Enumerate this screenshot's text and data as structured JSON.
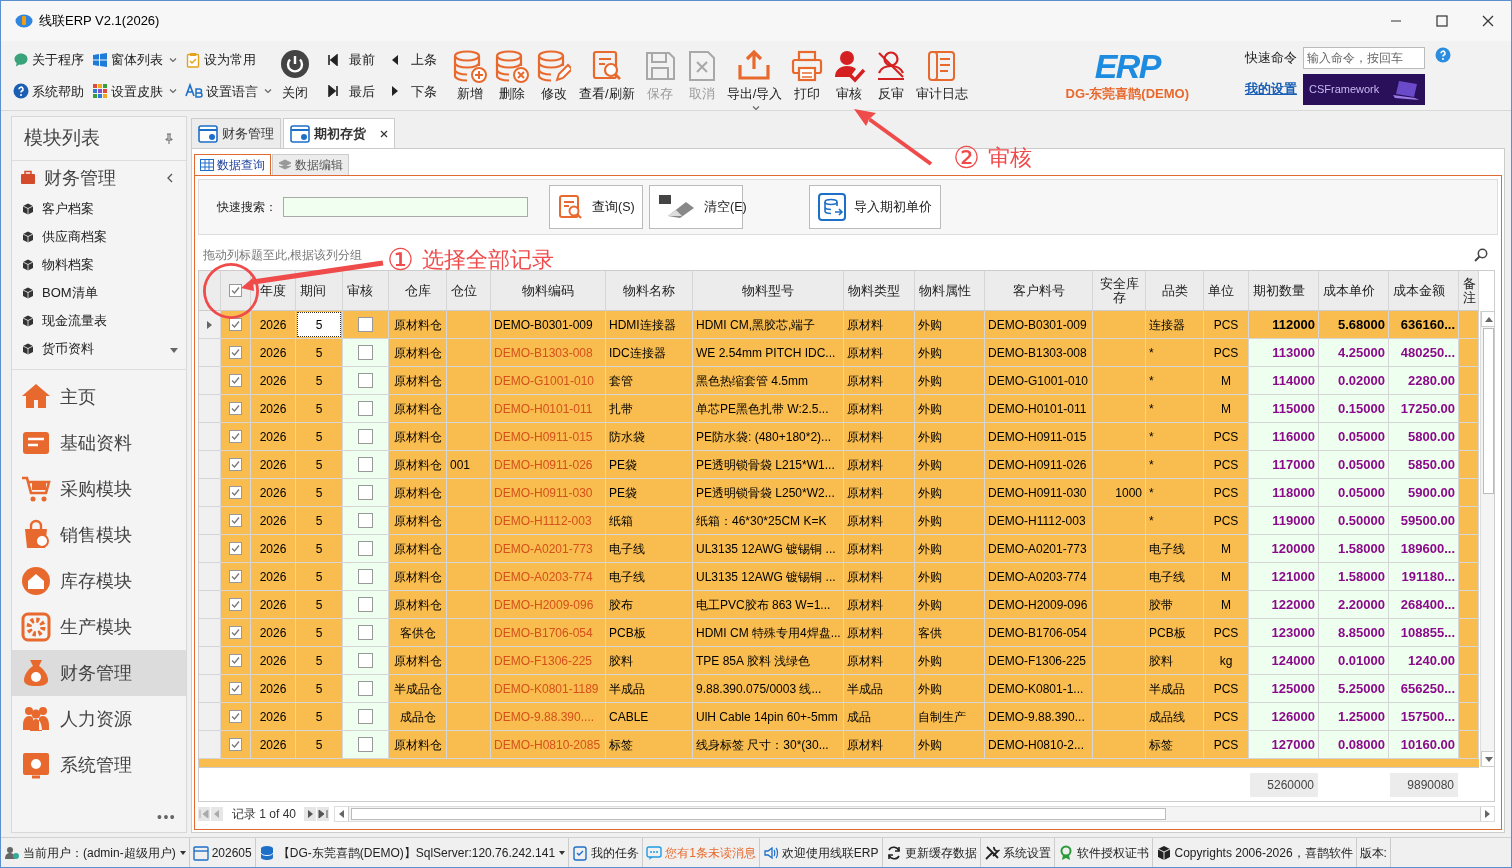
{
  "window": {
    "title": "线联ERP V2.1(2026)"
  },
  "toolbar": {
    "quick_links": [
      {
        "label": "关于程序",
        "dropdown": false
      },
      {
        "label": "窗体列表",
        "dropdown": true
      },
      {
        "label": "设为常用",
        "dropdown": false
      },
      {
        "label": "系统帮助",
        "dropdown": false
      },
      {
        "label": "设置皮肤",
        "dropdown": true
      },
      {
        "label": "设置语言",
        "dropdown": true
      }
    ],
    "close": "关闭",
    "nav": [
      "最前",
      "上条",
      "最后",
      "下条"
    ],
    "buttons": [
      {
        "label": "新增",
        "disabled": false,
        "dropdown": false
      },
      {
        "label": "删除",
        "disabled": false,
        "dropdown": false
      },
      {
        "label": "修改",
        "disabled": false,
        "dropdown": false
      },
      {
        "label": "查看/刷新",
        "disabled": false,
        "dropdown": false
      },
      {
        "label": "保存",
        "disabled": true,
        "dropdown": false
      },
      {
        "label": "取消",
        "disabled": true,
        "dropdown": false
      },
      {
        "label": "导出/导入",
        "disabled": false,
        "dropdown": true
      },
      {
        "label": "打印",
        "disabled": false,
        "dropdown": false
      },
      {
        "label": "审核",
        "disabled": false,
        "dropdown": false
      },
      {
        "label": "反审",
        "disabled": false,
        "dropdown": false
      },
      {
        "label": "审计日志",
        "disabled": false,
        "dropdown": false
      }
    ],
    "brand": {
      "logo": "ERP",
      "company": "DG-东莞喜鹊(DEMO)"
    },
    "quick_command": {
      "label": "快速命令",
      "placeholder": "输入命令，按回车"
    },
    "my_settings": "我的设置",
    "banner": "CSFramework"
  },
  "sidebar": {
    "title": "模块列表",
    "group": {
      "label": "财务管理",
      "expanded": true,
      "items": [
        "客户档案",
        "供应商档案",
        "物料档案",
        "BOM清单",
        "现金流量表",
        "货币资料"
      ]
    },
    "modules": [
      {
        "label": "主页",
        "selected": false
      },
      {
        "label": "基础资料",
        "selected": false
      },
      {
        "label": "采购模块",
        "selected": false
      },
      {
        "label": "销售模块",
        "selected": false
      },
      {
        "label": "库存模块",
        "selected": false
      },
      {
        "label": "生产模块",
        "selected": false
      },
      {
        "label": "财务管理",
        "selected": true
      },
      {
        "label": "人力资源",
        "selected": false
      },
      {
        "label": "系统管理",
        "selected": false
      }
    ],
    "more": "•••"
  },
  "tabs": [
    {
      "label": "财务管理",
      "selected": false,
      "closable": false
    },
    {
      "label": "期初存货",
      "selected": true,
      "closable": true
    }
  ],
  "subtabs": [
    {
      "label": "数据查询",
      "selected": true
    },
    {
      "label": "数据编辑",
      "selected": false
    }
  ],
  "search": {
    "label": "快速搜索：",
    "buttons": [
      "查询(S)",
      "清空(E)",
      "导入期初单价"
    ]
  },
  "group_hint": "拖动列标题至此,根据该列分组",
  "table": {
    "select_all_checked": true,
    "columns": [
      "年度",
      "期间",
      "审核",
      "仓库",
      "仓位",
      "物料编码",
      "物料名称",
      "物料型号",
      "物料类型",
      "物料属性",
      "客户料号",
      "安全库存",
      "品类",
      "单位",
      "期初数量",
      "成本单价",
      "成本金额",
      "备注"
    ],
    "rows": [
      {
        "focused": true,
        "selected": true,
        "audited": false,
        "year": "2026",
        "period": "5",
        "warehouse": "原材料仓",
        "code": "DEMO-B0301-009",
        "name": "HDMI连接器",
        "model": "HDMI CM,黑胶芯,端子",
        "type": "原材料",
        "attr": "外购",
        "customer_no": "DEMO-B0301-009",
        "category": "连接器",
        "unit": "PCS",
        "qty": "112000",
        "price": "5.68000",
        "amount": "636160..."
      },
      {
        "focused": false,
        "selected": true,
        "audited": false,
        "year": "2026",
        "period": "5",
        "warehouse": "原材料仓",
        "code": "DEMO-B1303-008",
        "name": "IDC连接器",
        "model": "WE 2.54mm PITCH IDC...",
        "type": "原材料",
        "attr": "外购",
        "customer_no": "DEMO-B1303-008",
        "category": "*",
        "unit": "PCS",
        "qty": "113000",
        "price": "4.25000",
        "amount": "480250..."
      },
      {
        "focused": false,
        "selected": true,
        "audited": false,
        "year": "2026",
        "period": "5",
        "warehouse": "原材料仓",
        "code": "DEMO-G1001-010",
        "name": "套管",
        "model": "黑色热缩套管 4.5mm",
        "type": "原材料",
        "attr": "外购",
        "customer_no": "DEMO-G1001-010",
        "category": "*",
        "unit": "M",
        "qty": "114000",
        "price": "0.02000",
        "amount": "2280.00"
      },
      {
        "focused": false,
        "selected": true,
        "audited": false,
        "year": "2026",
        "period": "5",
        "warehouse": "原材料仓",
        "code": "DEMO-H0101-011",
        "name": "扎带",
        "model": "单芯PE黑色扎带 W:2.5...",
        "type": "原材料",
        "attr": "外购",
        "customer_no": "DEMO-H0101-011",
        "category": "*",
        "unit": "M",
        "qty": "115000",
        "price": "0.15000",
        "amount": "17250.00"
      },
      {
        "focused": false,
        "selected": true,
        "audited": false,
        "year": "2026",
        "period": "5",
        "warehouse": "原材料仓",
        "code": "DEMO-H0911-015",
        "name": "防水袋",
        "model": "PE防水袋: (480+180*2)...",
        "type": "原材料",
        "attr": "外购",
        "customer_no": "DEMO-H0911-015",
        "category": "*",
        "unit": "PCS",
        "qty": "116000",
        "price": "0.05000",
        "amount": "5800.00"
      },
      {
        "focused": false,
        "selected": true,
        "audited": false,
        "year": "2026",
        "period": "5",
        "warehouse": "原材料仓",
        "location": "001",
        "code": "DEMO-H0911-026",
        "name": "PE袋",
        "model": "PE透明锁骨袋 L215*W1...",
        "type": "原材料",
        "attr": "外购",
        "customer_no": "DEMO-H0911-026",
        "category": "*",
        "unit": "PCS",
        "qty": "117000",
        "price": "0.05000",
        "amount": "5850.00"
      },
      {
        "focused": false,
        "selected": true,
        "audited": false,
        "year": "2026",
        "period": "5",
        "warehouse": "原材料仓",
        "code": "DEMO-H0911-030",
        "name": "PE袋",
        "model": "PE透明锁骨袋 L250*W2...",
        "type": "原材料",
        "attr": "外购",
        "customer_no": "DEMO-H0911-030",
        "safety_stock": "1000",
        "category": "*",
        "unit": "PCS",
        "qty": "118000",
        "price": "0.05000",
        "amount": "5900.00"
      },
      {
        "focused": false,
        "selected": true,
        "audited": false,
        "year": "2026",
        "period": "5",
        "warehouse": "原材料仓",
        "code": "DEMO-H1112-003",
        "name": "纸箱",
        "model": "纸箱：46*30*25CM K=K",
        "type": "原材料",
        "attr": "外购",
        "customer_no": "DEMO-H1112-003",
        "category": "*",
        "unit": "PCS",
        "qty": "119000",
        "price": "0.50000",
        "amount": "59500.00"
      },
      {
        "focused": false,
        "selected": true,
        "audited": false,
        "year": "2026",
        "period": "5",
        "warehouse": "原材料仓",
        "code": "DEMO-A0201-773",
        "name": "电子线",
        "model": "UL3135 12AWG 镀锡铜 ...",
        "type": "原材料",
        "attr": "外购",
        "customer_no": "DEMO-A0201-773",
        "category": "电子线",
        "unit": "M",
        "qty": "120000",
        "price": "1.58000",
        "amount": "189600..."
      },
      {
        "focused": false,
        "selected": true,
        "audited": false,
        "year": "2026",
        "period": "5",
        "warehouse": "原材料仓",
        "code": "DEMO-A0203-774",
        "name": "电子线",
        "model": "UL3135 12AWG 镀锡铜 ...",
        "type": "原材料",
        "attr": "外购",
        "customer_no": "DEMO-A0203-774",
        "category": "电子线",
        "unit": "M",
        "qty": "121000",
        "price": "1.58000",
        "amount": "191180..."
      },
      {
        "focused": false,
        "selected": true,
        "audited": false,
        "year": "2026",
        "period": "5",
        "warehouse": "原材料仓",
        "code": "DEMO-H2009-096",
        "name": "胶布",
        "model": "电工PVC胶布 863 W=1...",
        "type": "原材料",
        "attr": "外购",
        "customer_no": "DEMO-H2009-096",
        "category": "胶带",
        "unit": "M",
        "qty": "122000",
        "price": "2.20000",
        "amount": "268400..."
      },
      {
        "focused": false,
        "selected": true,
        "audited": false,
        "year": "2026",
        "period": "5",
        "warehouse": "客供仓",
        "code": "DEMO-B1706-054",
        "name": "PCB板",
        "model": "HDMI CM 特殊专用4焊盘...",
        "type": "原材料",
        "attr": "客供",
        "customer_no": "DEMO-B1706-054",
        "category": "PCB板",
        "unit": "PCS",
        "qty": "123000",
        "price": "8.85000",
        "amount": "108855..."
      },
      {
        "focused": false,
        "selected": true,
        "audited": false,
        "year": "2026",
        "period": "5",
        "warehouse": "原材料仓",
        "code": "DEMO-F1306-225",
        "name": "胶料",
        "model": "TPE 85A 胶料 浅绿色",
        "type": "原材料",
        "attr": "外购",
        "customer_no": "DEMO-F1306-225",
        "category": "胶料",
        "unit": "kg",
        "qty": "124000",
        "price": "0.01000",
        "amount": "1240.00"
      },
      {
        "focused": false,
        "selected": true,
        "audited": false,
        "year": "2026",
        "period": "5",
        "warehouse": "半成品仓",
        "code": "DEMO-K0801-1189",
        "name": "半成品",
        "model": "9.88.390.075/0003 线...",
        "type": "半成品",
        "attr": "外购",
        "customer_no": "DEMO-K0801-1...",
        "category": "半成品",
        "unit": "PCS",
        "qty": "125000",
        "price": "5.25000",
        "amount": "656250..."
      },
      {
        "focused": false,
        "selected": true,
        "audited": false,
        "year": "2026",
        "period": "5",
        "warehouse": "成品仓",
        "code": "DEMO-9.88.390....",
        "name": "CABLE",
        "model": "UlH Cable 14pin 60+-5mm",
        "type": "成品",
        "attr": "自制生产",
        "customer_no": "DEMO-9.88.390...",
        "category": "成品线",
        "unit": "PCS",
        "qty": "126000",
        "price": "1.25000",
        "amount": "157500..."
      },
      {
        "focused": false,
        "selected": true,
        "audited": false,
        "year": "2026",
        "period": "5",
        "warehouse": "原材料仓",
        "code": "DEMO-H0810-2085",
        "name": "标签",
        "model": "线身标签 尺寸：30*(30...",
        "type": "原材料",
        "attr": "外购",
        "customer_no": "DEMO-H0810-2...",
        "category": "标签",
        "unit": "PCS",
        "qty": "127000",
        "price": "0.08000",
        "amount": "10160.00"
      }
    ],
    "totals": {
      "qty": "5260000",
      "amount": "9890080"
    }
  },
  "pager": "记录 1 of 40",
  "annotations": [
    {
      "number": "①",
      "text": "选择全部记录"
    },
    {
      "number": "②",
      "text": "审核"
    }
  ],
  "status_bar": [
    {
      "text": "当前用户：(admin-超级用户)",
      "dropdown": true,
      "highlight": false
    },
    {
      "text": "202605",
      "dropdown": false,
      "highlight": false
    },
    {
      "text": "【DG-东莞喜鹊(DEMO)】SqlServer:120.76.242.141",
      "dropdown": true,
      "highlight": false
    },
    {
      "text": "我的任务",
      "dropdown": false,
      "highlight": false
    },
    {
      "text": "您有1条未读消息",
      "dropdown": false,
      "highlight": true
    },
    {
      "text": "欢迎使用线联ERP",
      "dropdown": false,
      "highlight": false
    },
    {
      "text": "更新缓存数据",
      "dropdown": false,
      "highlight": false
    },
    {
      "text": "系统设置",
      "dropdown": false,
      "highlight": false
    },
    {
      "text": "软件授权证书",
      "dropdown": false,
      "highlight": false
    },
    {
      "text": "Copyrights 2006-2026，喜鹊软件",
      "dropdown": false,
      "highlight": false
    },
    {
      "text": "版本:",
      "dropdown": false,
      "highlight": false
    }
  ]
}
